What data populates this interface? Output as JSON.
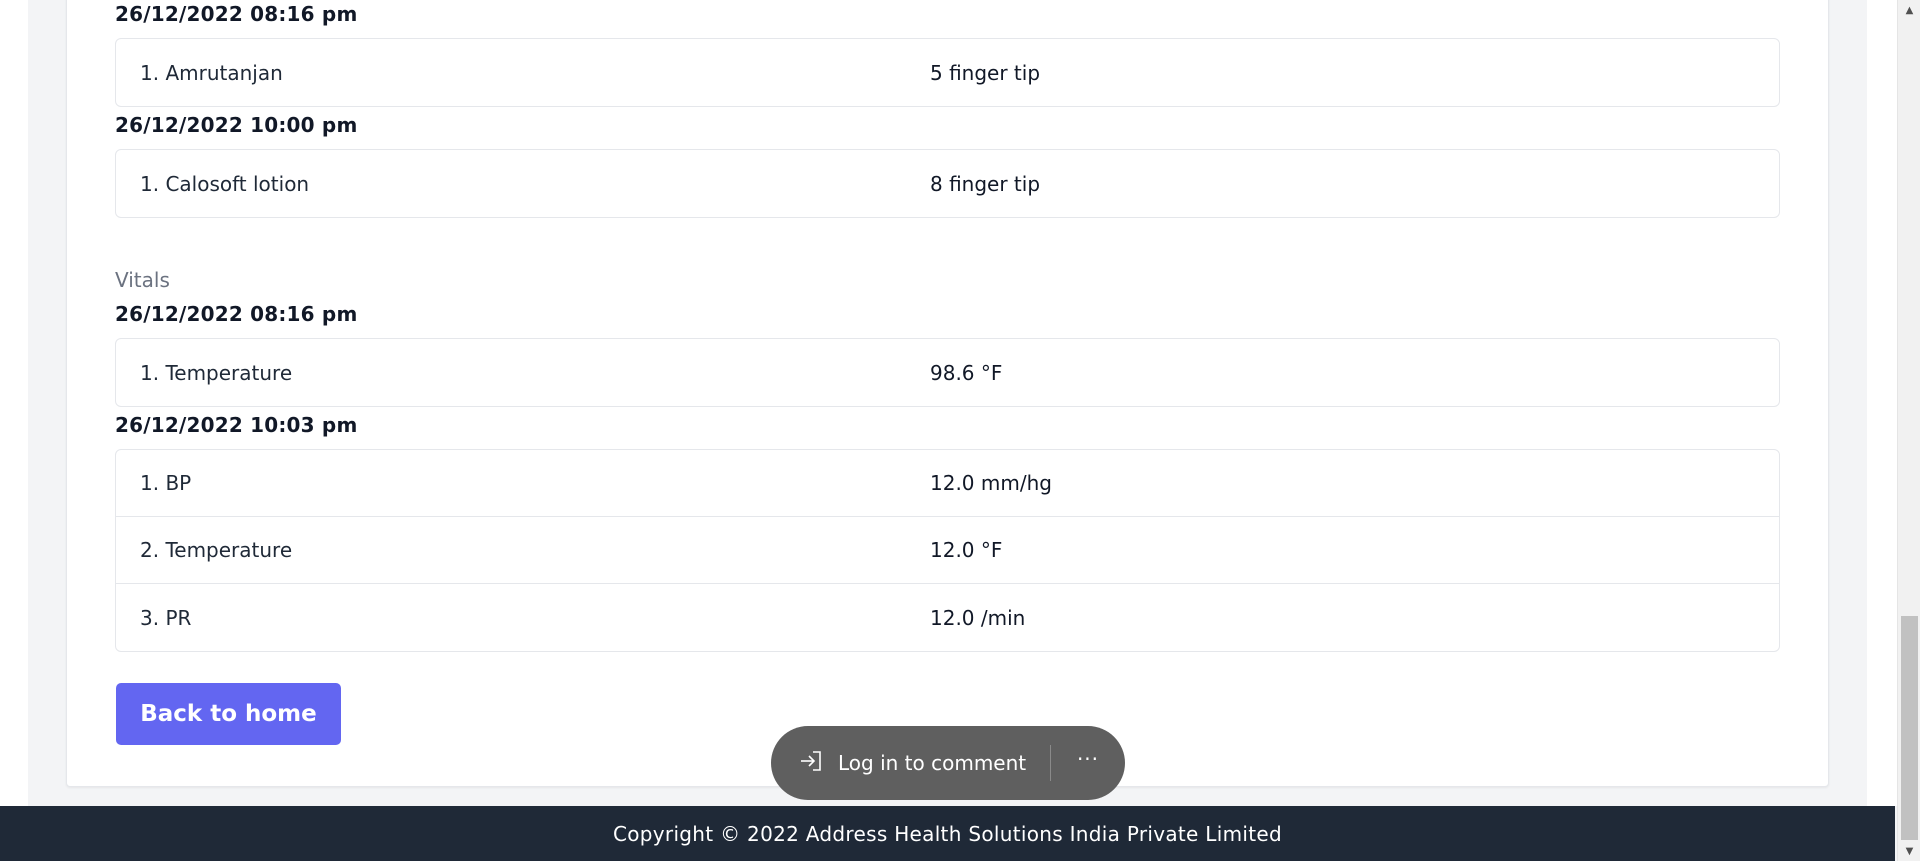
{
  "medications": {
    "groups": [
      {
        "date": "26/12/2022 08:16 pm",
        "rows": [
          {
            "name": "1. Amrutanjan",
            "value": "5 finger tip"
          }
        ]
      },
      {
        "date": "26/12/2022 10:00 pm",
        "rows": [
          {
            "name": "1. Calosoft lotion",
            "value": "8 finger tip"
          }
        ]
      }
    ]
  },
  "vitals": {
    "label": "Vitals",
    "groups": [
      {
        "date": "26/12/2022 08:16 pm",
        "rows": [
          {
            "name": "1. Temperature",
            "value": "98.6 °F"
          }
        ]
      },
      {
        "date": "26/12/2022 10:03 pm",
        "rows": [
          {
            "name": "1. BP",
            "value": "12.0 mm/hg"
          },
          {
            "name": "2. Temperature",
            "value": "12.0 °F"
          },
          {
            "name": "3. PR",
            "value": "12.0 /min"
          }
        ]
      }
    ]
  },
  "actions": {
    "back_label": "Back to home"
  },
  "comment_bar": {
    "login_label": "Log in to comment",
    "more_label": "···"
  },
  "footer": {
    "copyright": "Copyright © 2022 Address Health Solutions India Private Limited"
  },
  "colors": {
    "primary": "#6366f1",
    "footer_bg": "#1f2937",
    "page_bg": "#f3f4f6"
  },
  "icons": {
    "login": "sign-in-icon",
    "scroll_up": "triangle-up-icon",
    "scroll_down": "triangle-down-icon"
  }
}
